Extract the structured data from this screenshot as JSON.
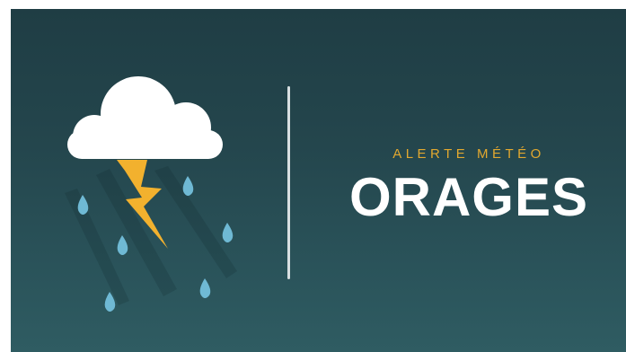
{
  "alert": {
    "subtitle": "ALERTE MÉTÉO",
    "title": "ORAGES"
  },
  "icons": {
    "cloud": "cloud-icon",
    "lightning": "lightning-bolt-icon",
    "raindrop": "raindrop-icon"
  },
  "colors": {
    "background": "#24464d",
    "accent": "#e2a82f",
    "lightning": "#f2b12e",
    "raindrop": "#6fb9d4",
    "title": "#ffffff"
  }
}
